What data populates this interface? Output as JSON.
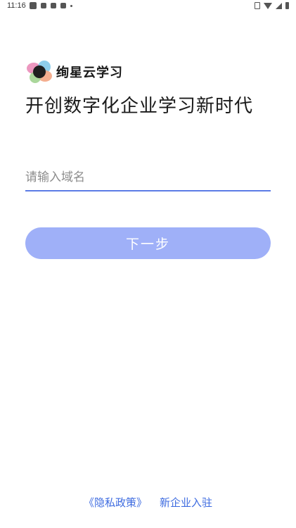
{
  "status_bar": {
    "time": "11:16"
  },
  "brand": {
    "name": "绚星云学习",
    "logo_colors": [
      "#f2a07b",
      "#e985b4",
      "#7ac6e8",
      "#9bd08a",
      "#1f1f1f"
    ]
  },
  "tagline": "开创数字化企业学习新时代",
  "domain_input": {
    "placeholder": "请输入域名",
    "value": ""
  },
  "next_button": {
    "label": "下一步",
    "color": "#9fb0f8"
  },
  "footer": {
    "privacy_policy": "《隐私政策》",
    "new_enterprise": "新企业入驻",
    "link_color": "#3d6be0"
  }
}
